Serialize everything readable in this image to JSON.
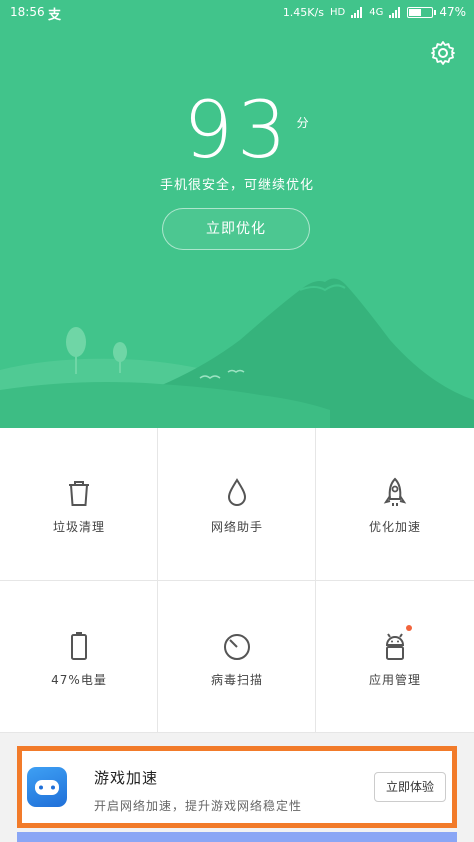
{
  "status_bar": {
    "time": "18:56",
    "app_glyph": "支",
    "net_speed": "1.45K/s",
    "hd_badge": "HD",
    "network_type": "4G",
    "battery_percent": "47%",
    "battery_level": 0.47
  },
  "hero": {
    "score": "93",
    "score_unit": "分",
    "safety_text": "手机很安全，可继续优化",
    "optimize_button": "立即优化"
  },
  "tools": [
    {
      "label": "垃圾清理",
      "icon": "trash-icon"
    },
    {
      "label": "网络助手",
      "icon": "water-drop-icon"
    },
    {
      "label": "优化加速",
      "icon": "rocket-icon"
    },
    {
      "label": "47%电量",
      "icon": "battery-icon"
    },
    {
      "label": "病毒扫描",
      "icon": "scan-icon"
    },
    {
      "label": "应用管理",
      "icon": "android-icon"
    }
  ],
  "game_card": {
    "title": "游戏加速",
    "description": "开启网络加速，提升游戏网络稳定性",
    "button": "立即体验"
  },
  "colors": {
    "hero_green": "#41c48b",
    "highlight_border": "#f27b2a",
    "notification_dot": "#f2643c"
  }
}
